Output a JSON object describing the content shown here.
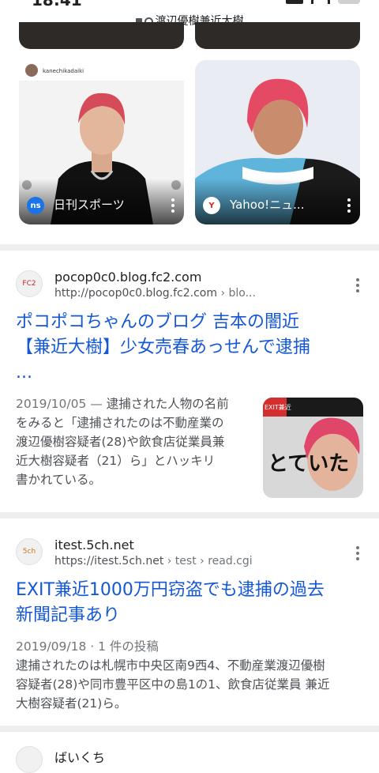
{
  "status_bar": {
    "time": "18:41",
    "battery": "10"
  },
  "address_bar": {
    "query": "渡辺優樹兼近大樹"
  },
  "image_cards": [
    {
      "source": "日刊スポーツ",
      "badge": "ns",
      "badge_color": "#1a73e8",
      "caption_tag": "kanechikadaiki"
    },
    {
      "source": "Yahoo!ニュ...",
      "badge": "Y",
      "badge_color": "#d93025"
    }
  ],
  "results": [
    {
      "site": "pocop0c0.blog.fc2.com",
      "url": "http://pocop0c0.blog.fc2.com",
      "url_crumb": " › blo...",
      "favicon_label": "FC2",
      "title_lines": [
        "ポコポコちゃんのブログ 吉本の闇近",
        "【兼近大樹】少女売春あっせんで逮捕",
        "..."
      ],
      "date": "2019/10/05 —",
      "snippet_lines": [
        " 逮捕された人物の名前",
        "をみると「逮捕されたのは不動産業の",
        "渡辺優樹容疑者(28)や飲食店従業員兼",
        "近大樹容疑者（21）ら」とハッキリ",
        "書かれている。"
      ],
      "thumb_text": "とていた",
      "thumb_banner": "EXIT兼近"
    },
    {
      "site": "itest.5ch.net",
      "url": "https://itest.5ch.net",
      "url_crumb": " › test › read.cgi",
      "favicon_label": "5ch",
      "title_lines": [
        "EXIT兼近1000万円窃盗でも逮捕の過去",
        "新聞記事あり"
      ],
      "date": "2019/09/18 · 1 件の投稿",
      "snippet_lines": [
        "逮捕されたのは札幌市中央区南9西4、不動産業渡辺優樹",
        "容疑者(28)や同市豊平区中の島1の1、飲食店従業員 兼近",
        "大樹容疑者(21)ら。"
      ]
    }
  ],
  "next_result": {
    "site": "ばいくち"
  }
}
